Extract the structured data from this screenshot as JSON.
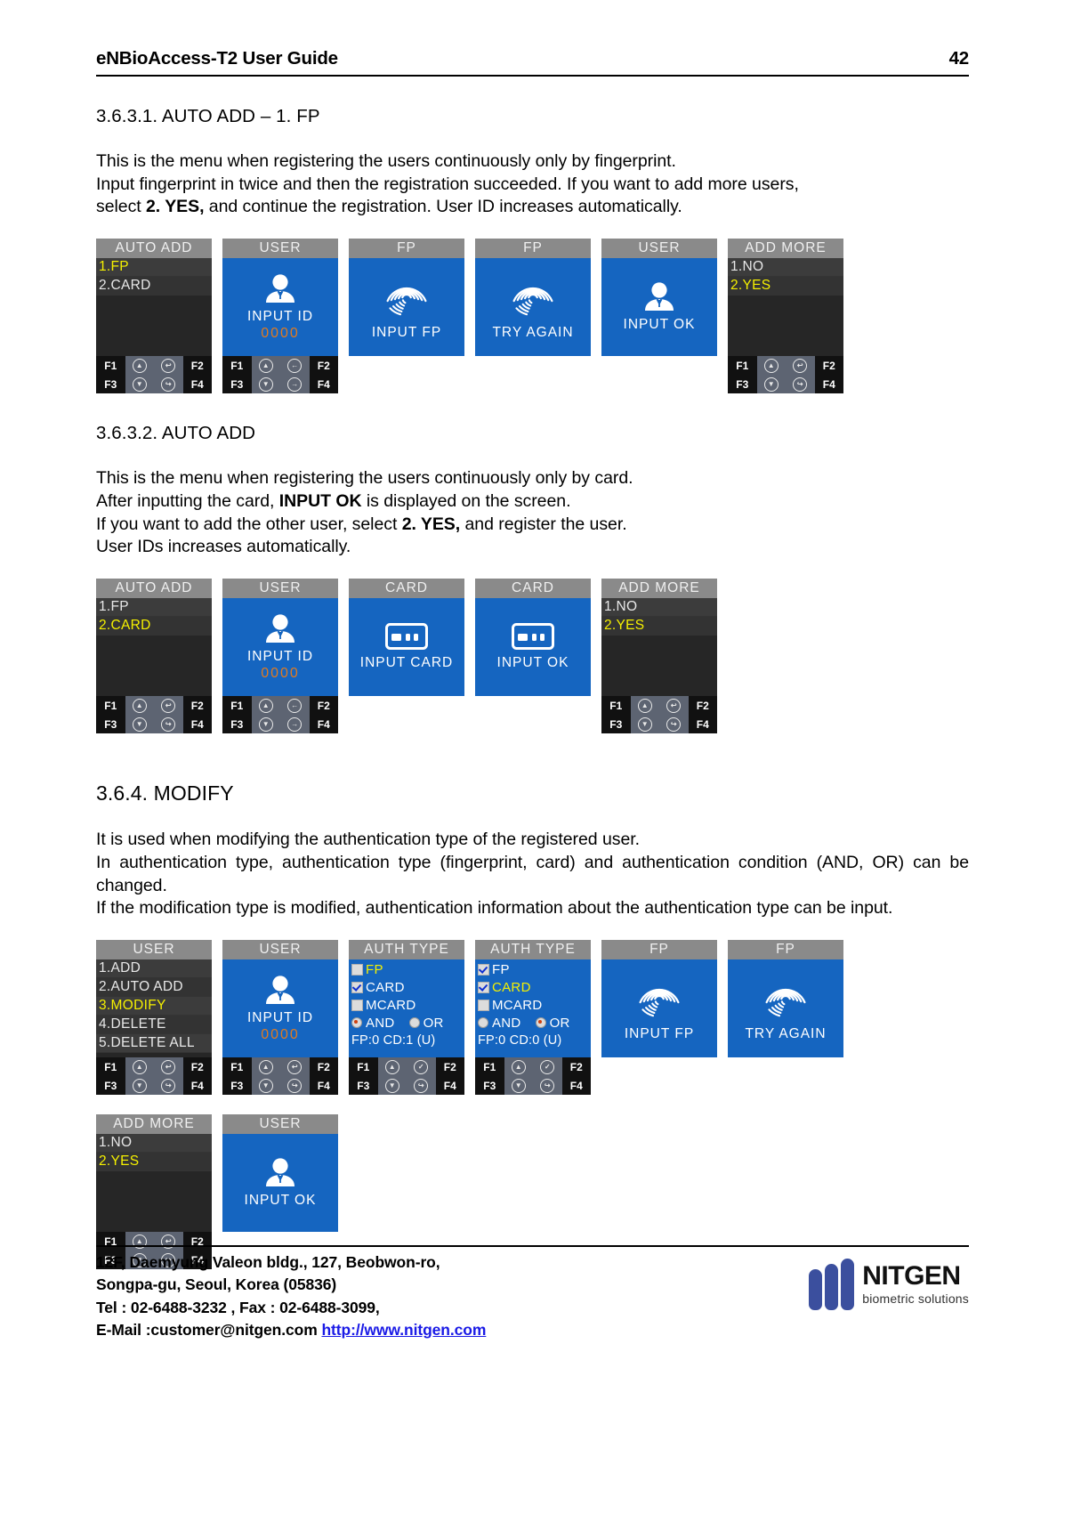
{
  "header": {
    "title": "eNBioAccess-T2 User Guide",
    "page_number": "42"
  },
  "sections": [
    {
      "heading": "3.6.3.1. AUTO ADD – 1. FP",
      "paragraphs": [
        "This is the menu when registering the users continuously only by fingerprint.",
        "Input fingerprint in twice and then the registration succeeded. If you want to add more users,",
        "select 2. YES, and continue the registration. User ID increases automatically."
      ]
    },
    {
      "heading": "3.6.3.2. AUTO ADD",
      "paragraphs": [
        "This is the menu when registering the users continuously only by card.",
        "After inputting the card, INPUT OK is displayed on the screen.",
        "If you want to add the other user, select 2. YES, and register the user.",
        "User IDs increases automatically."
      ]
    },
    {
      "heading": "3.6.4. MODIFY",
      "paragraphs": [
        "It is used when modifying the authentication type of the registered user.",
        "In authentication type, authentication type (fingerprint, card) and authentication condition (AND, OR) can be changed.",
        "If the modification type is modified, authentication information about the authentication type can be input."
      ]
    }
  ],
  "keypad": {
    "f1": "F1",
    "f2": "F2",
    "f3": "F3",
    "f4": "F4",
    "up": "▲",
    "down": "▼",
    "back": "↩",
    "enter": "↪",
    "left": "←",
    "right": "→",
    "ok": "✓"
  },
  "strip1": [
    {
      "title": "AUTO ADD",
      "kind": "menu",
      "items": [
        {
          "label": "1.FP",
          "selected": true
        },
        {
          "label": "2.CARD",
          "selected": false
        }
      ],
      "keys": [
        "F1",
        "up",
        "back",
        "F2",
        "F3",
        "down",
        "enter",
        "F4"
      ]
    },
    {
      "title": "USER",
      "kind": "id",
      "icon": "user-icon",
      "caption": "INPUT ID",
      "value": "0000",
      "keys": [
        "F1",
        "up",
        "left",
        "F2",
        "F3",
        "down",
        "right",
        "F4"
      ]
    },
    {
      "title": "FP",
      "kind": "icon",
      "icon": "fingerprint-icon",
      "caption": "INPUT FP",
      "keys": []
    },
    {
      "title": "FP",
      "kind": "icon",
      "icon": "fingerprint-icon",
      "caption": "TRY AGAIN",
      "keys": []
    },
    {
      "title": "USER",
      "kind": "icon",
      "icon": "user-icon",
      "caption": "INPUT OK",
      "keys": []
    },
    {
      "title": "ADD MORE",
      "kind": "menu",
      "items": [
        {
          "label": "1.NO",
          "selected": false
        },
        {
          "label": "2.YES",
          "selected": true
        }
      ],
      "keys": [
        "F1",
        "up",
        "back",
        "F2",
        "F3",
        "down",
        "enter",
        "F4"
      ]
    }
  ],
  "strip2": [
    {
      "title": "AUTO ADD",
      "kind": "menu",
      "items": [
        {
          "label": "1.FP",
          "selected": false
        },
        {
          "label": "2.CARD",
          "selected": true
        }
      ],
      "keys": [
        "F1",
        "up",
        "back",
        "F2",
        "F3",
        "down",
        "enter",
        "F4"
      ]
    },
    {
      "title": "USER",
      "kind": "id",
      "icon": "user-icon",
      "caption": "INPUT ID",
      "value": "0000",
      "keys": [
        "F1",
        "up",
        "left",
        "F2",
        "F3",
        "down",
        "right",
        "F4"
      ]
    },
    {
      "title": "CARD",
      "kind": "icon",
      "icon": "card-icon",
      "caption": "INPUT CARD",
      "keys": []
    },
    {
      "title": "CARD",
      "kind": "icon",
      "icon": "card-icon",
      "caption": "INPUT OK",
      "keys": []
    },
    {
      "title": "ADD MORE",
      "kind": "menu",
      "items": [
        {
          "label": "1.NO",
          "selected": false
        },
        {
          "label": "2.YES",
          "selected": true
        }
      ],
      "keys": [
        "F1",
        "up",
        "back",
        "F2",
        "F3",
        "down",
        "enter",
        "F4"
      ]
    }
  ],
  "strip3": [
    {
      "title": "USER",
      "kind": "menu",
      "items": [
        {
          "label": "1.ADD",
          "selected": false
        },
        {
          "label": "2.AUTO ADD",
          "selected": false
        },
        {
          "label": "3.MODIFY",
          "selected": true
        },
        {
          "label": "4.DELETE",
          "selected": false
        },
        {
          "label": "5.DELETE ALL",
          "selected": false
        }
      ],
      "keys": [
        "F1",
        "up",
        "back",
        "F2",
        "F3",
        "down",
        "enter",
        "F4"
      ]
    },
    {
      "title": "USER",
      "kind": "id",
      "icon": "user-icon",
      "caption": "INPUT ID",
      "value": "0000",
      "keys": [
        "F1",
        "up",
        "back",
        "F2",
        "F3",
        "down",
        "enter",
        "F4"
      ]
    },
    {
      "title": "AUTH TYPE",
      "kind": "auth",
      "checks": [
        {
          "label": "FP",
          "checked": false,
          "selected": true
        },
        {
          "label": "CARD",
          "checked": true,
          "selected": false
        },
        {
          "label": "MCARD",
          "checked": false,
          "selected": false
        }
      ],
      "radios": [
        {
          "label": "AND",
          "on": true,
          "style": "orange"
        },
        {
          "label": "OR",
          "on": false,
          "style": "orange"
        }
      ],
      "status": "FP:0 CD:1 (U)",
      "keys": [
        "F1",
        "up",
        "ok",
        "F2",
        "F3",
        "down",
        "enter",
        "F4"
      ]
    },
    {
      "title": "AUTH TYPE",
      "kind": "auth",
      "checks": [
        {
          "label": "FP",
          "checked": true,
          "selected": false
        },
        {
          "label": "CARD",
          "checked": true,
          "selected": true
        },
        {
          "label": "MCARD",
          "checked": false,
          "selected": false
        }
      ],
      "radios": [
        {
          "label": "AND",
          "on": false,
          "style": "grey"
        },
        {
          "label": "OR",
          "on": true,
          "style": "orange"
        }
      ],
      "status": "FP:0 CD:0 (U)",
      "keys": [
        "F1",
        "up",
        "ok",
        "F2",
        "F3",
        "down",
        "enter",
        "F4"
      ]
    },
    {
      "title": "FP",
      "kind": "icon",
      "icon": "fingerprint-icon",
      "caption": "INPUT FP",
      "keys": []
    },
    {
      "title": "FP",
      "kind": "icon",
      "icon": "fingerprint-icon",
      "caption": "TRY AGAIN",
      "keys": []
    }
  ],
  "strip4": [
    {
      "title": "ADD MORE",
      "kind": "menu",
      "items": [
        {
          "label": "1.NO",
          "selected": false
        },
        {
          "label": "2.YES",
          "selected": true
        }
      ],
      "keys": [
        "F1",
        "up",
        "back",
        "F2",
        "F3",
        "down",
        "enter",
        "F4"
      ]
    },
    {
      "title": "USER",
      "kind": "icon",
      "icon": "user-icon",
      "caption": "INPUT OK",
      "keys": []
    }
  ],
  "footer": {
    "line1": "12F, Daemyung Valeon bldg., 127, Beobwon-ro,",
    "line2": "Songpa-gu, Seoul, Korea (05836)",
    "line3": "Tel : 02-6488-3232 , Fax : 02-6488-3099,",
    "line4_label": "E-Mail :customer@nitgen.com ",
    "line4_link": "http://www.nitgen.com",
    "logo_name": "NITGEN",
    "logo_tagline": "biometric solutions"
  }
}
